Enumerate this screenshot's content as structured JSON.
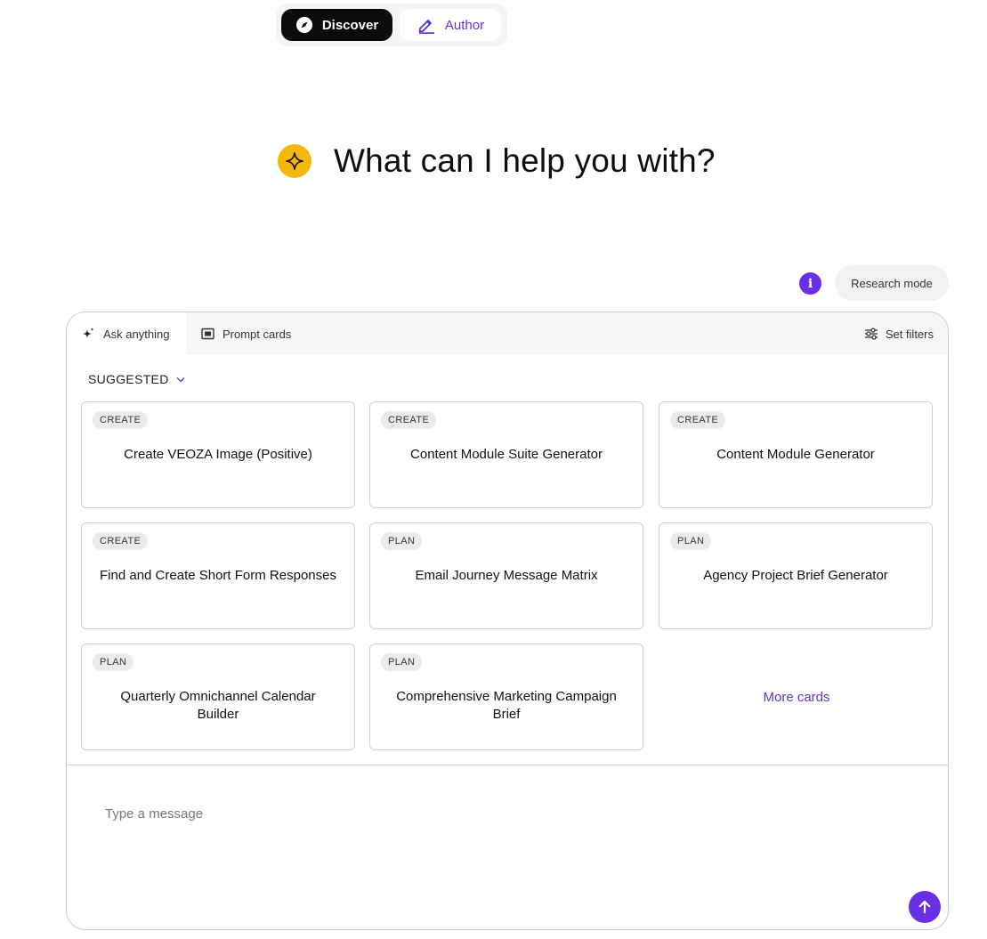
{
  "mode_switch": {
    "discover_label": "Discover",
    "author_label": "Author",
    "active": "Discover"
  },
  "hero": {
    "title": "What can I help you with?"
  },
  "toolbar": {
    "info_glyph": "i",
    "research_mode_label": "Research mode"
  },
  "tabs": {
    "ask_anything": "Ask anything",
    "prompt_cards": "Prompt cards",
    "active": "Ask anything"
  },
  "filters": {
    "set_filters_label": "Set filters"
  },
  "suggested": {
    "label": "SUGGESTED"
  },
  "cards": [
    {
      "tag": "CREATE",
      "title": "Create VEOZA Image (Positive)"
    },
    {
      "tag": "CREATE",
      "title": "Content Module Suite Generator"
    },
    {
      "tag": "CREATE",
      "title": "Content Module Generator"
    },
    {
      "tag": "CREATE",
      "title": "Find and Create Short Form Responses"
    },
    {
      "tag": "PLAN",
      "title": "Email Journey Message Matrix"
    },
    {
      "tag": "PLAN",
      "title": "Agency Project Brief Generator"
    },
    {
      "tag": "PLAN",
      "title": "Quarterly Omnichannel Calendar Builder"
    },
    {
      "tag": "PLAN",
      "title": "Comprehensive Marketing Campaign Brief"
    }
  ],
  "more_cards_label": "More cards",
  "composer": {
    "placeholder": "Type a message",
    "value": ""
  },
  "colors": {
    "accent": "#6a2ee6",
    "hero_badge": "#f5b80a",
    "discover_bg": "#0b0b0b"
  },
  "icons": {
    "discover": "compass-icon",
    "author": "pencil-icon",
    "hero": "sparkle-icon",
    "ask_anything": "sparkles-icon",
    "prompt_cards": "card-icon",
    "set_filters": "sliders-icon",
    "suggested": "chevron-down-icon",
    "send": "arrow-up-icon",
    "info": "info-icon"
  }
}
